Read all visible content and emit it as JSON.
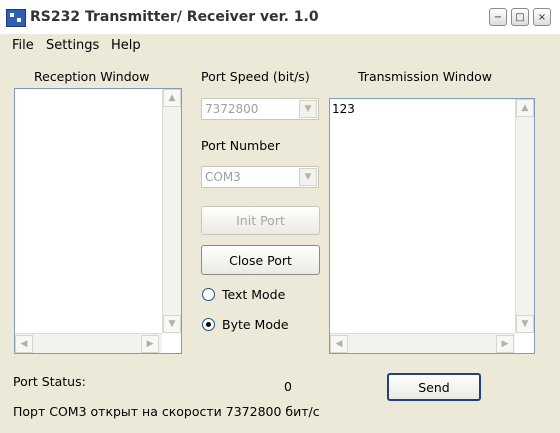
{
  "window": {
    "title": "RS232 Transmitter/ Receiver ver. 1.0"
  },
  "menu": {
    "file": "File",
    "settings": "Settings",
    "help": "Help"
  },
  "reception": {
    "label": "Reception Window",
    "content": ""
  },
  "port_speed": {
    "label": "Port Speed (bit/s)",
    "value": "7372800"
  },
  "port_number": {
    "label": "Port Number",
    "value": "COM3"
  },
  "buttons": {
    "init_port": "Init Port",
    "close_port": "Close Port",
    "send": "Send"
  },
  "modes": {
    "text_mode": "Text Mode",
    "byte_mode": "Byte Mode",
    "selected": "byte_mode"
  },
  "transmission": {
    "label": "Transmission Window",
    "content": "123"
  },
  "status": {
    "label": "Port Status:",
    "count": "0",
    "message": "Порт COM3 открыт на скорости 7372800 бит/с"
  }
}
